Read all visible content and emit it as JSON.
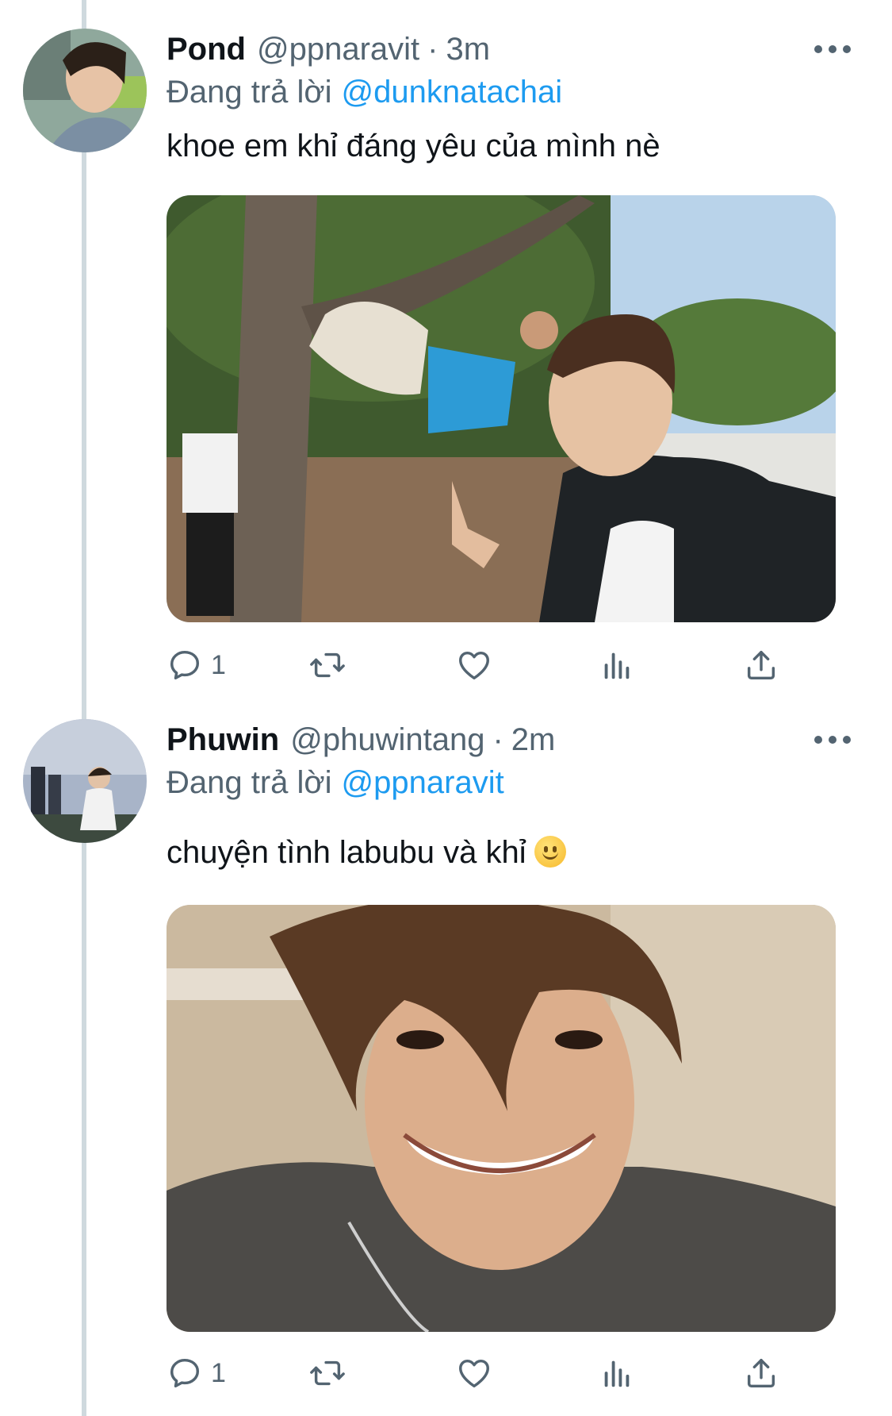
{
  "tweets": [
    {
      "display_name": "Pond",
      "handle": "@ppnaravit",
      "separator": "·",
      "time": "3m",
      "replying_prefix": "Đang trả lời",
      "replying_to": "@dunknatachai",
      "text": "khoe em khỉ đáng yêu của mình nè",
      "reply_count": "1"
    },
    {
      "display_name": "Phuwin",
      "handle": "@phuwintang",
      "separator": "·",
      "time": "2m",
      "replying_prefix": "Đang trả lời",
      "replying_to": "@ppnaravit",
      "text": "chuyện tình labubu và khỉ",
      "emoji": "slightly-smiling-face",
      "reply_count": "1"
    }
  ],
  "icons": {
    "reply": "reply-icon",
    "retweet": "retweet-icon",
    "like": "heart-icon",
    "views": "views-icon",
    "share": "share-icon",
    "more": "more-icon"
  },
  "colors": {
    "link": "#1d9bf0",
    "secondary_text": "#536471",
    "thread_line": "#cfd9de"
  }
}
